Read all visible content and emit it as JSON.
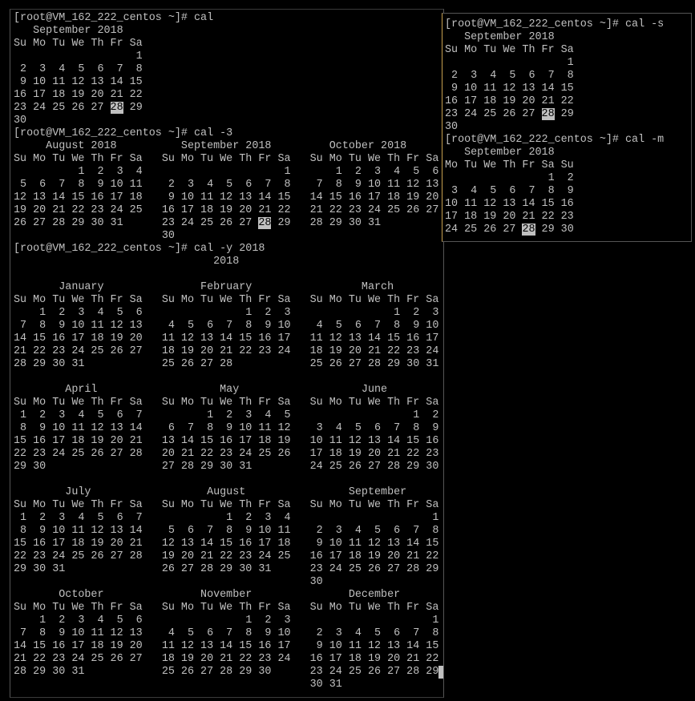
{
  "colors": {
    "background": "#000000",
    "text": "#c0c0c0",
    "highlight_bg": "#c0c0c0",
    "highlight_fg": "#000000",
    "window_accent": "#c8a050"
  },
  "left_terminal": {
    "lines": [
      "[root@VM_162_222_centos ~]# cal",
      "   September 2018",
      "Su Mo Tu We Th Fr Sa",
      "                   1",
      " 2  3  4  5  6  7  8",
      " 9 10 11 12 13 14 15",
      "16 17 18 19 20 21 22",
      "23 24 25 26 27 28 29",
      "30",
      "[root@VM_162_222_centos ~]# cal -3",
      "     August 2018          September 2018         October 2018",
      "Su Mo Tu We Th Fr Sa   Su Mo Tu We Th Fr Sa   Su Mo Tu We Th Fr Sa",
      "          1  2  3  4                      1       1  2  3  4  5  6",
      " 5  6  7  8  9 10 11    2  3  4  5  6  7  8    7  8  9 10 11 12 13",
      "12 13 14 15 16 17 18    9 10 11 12 13 14 15   14 15 16 17 18 19 20",
      "19 20 21 22 23 24 25   16 17 18 19 20 21 22   21 22 23 24 25 26 27",
      "26 27 28 29 30 31      23 24 25 26 27 28 29   28 29 30 31",
      "                       30",
      "[root@VM_162_222_centos ~]# cal -y 2018",
      "                               2018",
      "",
      "       January               February                 March",
      "Su Mo Tu We Th Fr Sa   Su Mo Tu We Th Fr Sa   Su Mo Tu We Th Fr Sa",
      "    1  2  3  4  5  6                1  2  3                1  2  3",
      " 7  8  9 10 11 12 13    4  5  6  7  8  9 10    4  5  6  7  8  9 10",
      "14 15 16 17 18 19 20   11 12 13 14 15 16 17   11 12 13 14 15 16 17",
      "21 22 23 24 25 26 27   18 19 20 21 22 23 24   18 19 20 21 22 23 24",
      "28 29 30 31            25 26 27 28            25 26 27 28 29 30 31",
      "",
      "        April                   May                   June",
      "Su Mo Tu We Th Fr Sa   Su Mo Tu We Th Fr Sa   Su Mo Tu We Th Fr Sa",
      " 1  2  3  4  5  6  7          1  2  3  4  5                   1  2",
      " 8  9 10 11 12 13 14    6  7  8  9 10 11 12    3  4  5  6  7  8  9",
      "15 16 17 18 19 20 21   13 14 15 16 17 18 19   10 11 12 13 14 15 16",
      "22 23 24 25 26 27 28   20 21 22 23 24 25 26   17 18 19 20 21 22 23",
      "29 30                  27 28 29 30 31         24 25 26 27 28 29 30",
      "",
      "        July                  August                September",
      "Su Mo Tu We Th Fr Sa   Su Mo Tu We Th Fr Sa   Su Mo Tu We Th Fr Sa",
      " 1  2  3  4  5  6  7             1  2  3  4                      1",
      " 8  9 10 11 12 13 14    5  6  7  8  9 10 11    2  3  4  5  6  7  8",
      "15 16 17 18 19 20 21   12 13 14 15 16 17 18    9 10 11 12 13 14 15",
      "22 23 24 25 26 27 28   19 20 21 22 23 24 25   16 17 18 19 20 21 22",
      "29 30 31               26 27 28 29 30 31      23 24 25 26 27 28 29",
      "                                              30",
      "       October               November               December",
      "Su Mo Tu We Th Fr Sa   Su Mo Tu We Th Fr Sa   Su Mo Tu We Th Fr Sa",
      "    1  2  3  4  5  6                1  2  3                      1",
      " 7  8  9 10 11 12 13    4  5  6  7  8  9 10    2  3  4  5  6  7  8",
      "14 15 16 17 18 19 20   11 12 13 14 15 16 17    9 10 11 12 13 14 15",
      "21 22 23 24 25 26 27   18 19 20 21 22 23 24   16 17 18 19 20 21 22",
      "28 29 30 31            25 26 27 28 29 30      23 24 25 26 27 28 29",
      "                                              30 31"
    ],
    "highlights": [
      {
        "line": 7,
        "text": "28",
        "occurrence": 1
      },
      {
        "line": 16,
        "text": "28",
        "occurrence": 2
      },
      {
        "line": 43,
        "text": "28",
        "occurrence": 3
      }
    ],
    "cursor_line": 51
  },
  "right_terminal": {
    "lines": [
      "[root@VM_162_222_centos ~]# cal -s",
      "   September 2018",
      "Su Mo Tu We Th Fr Sa",
      "                   1",
      " 2  3  4  5  6  7  8",
      " 9 10 11 12 13 14 15",
      "16 17 18 19 20 21 22",
      "23 24 25 26 27 28 29",
      "30",
      "[root@VM_162_222_centos ~]# cal -m",
      "   September 2018",
      "Mo Tu We Th Fr Sa Su",
      "                1  2",
      " 3  4  5  6  7  8  9",
      "10 11 12 13 14 15 16",
      "17 18 19 20 21 22 23",
      "24 25 26 27 28 29 30"
    ],
    "highlights": [
      {
        "line": 7,
        "text": "28",
        "occurrence": 1
      },
      {
        "line": 16,
        "text": "28",
        "occurrence": 1
      }
    ]
  }
}
